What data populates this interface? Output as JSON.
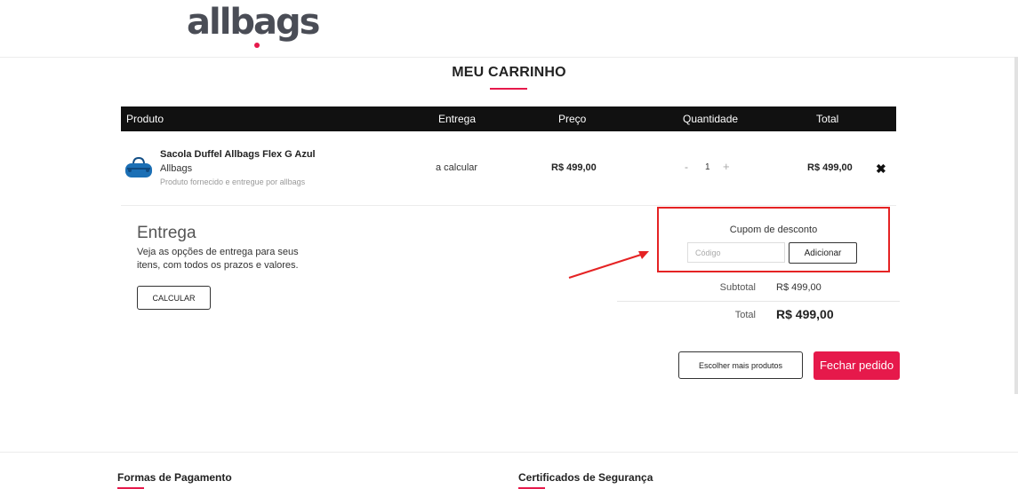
{
  "brand": {
    "logo_text": "allbags",
    "accent_color": "#e6194b"
  },
  "page": {
    "title": "MEU CARRINHO"
  },
  "cart_table": {
    "headers": {
      "product": "Produto",
      "shipping": "Entrega",
      "price": "Preço",
      "quantity": "Quantidade",
      "total": "Total"
    },
    "items": [
      {
        "name": "Sacola Duffel Allbags Flex G Azul",
        "brand": "Allbags",
        "note": "Produto fornecido e entregue por allbags",
        "shipping": "a calcular",
        "price": "R$ 499,00",
        "quantity": "1",
        "total": "R$ 499,00",
        "icon": "duffel-bag-icon",
        "icon_color": "#1b6fb5"
      }
    ],
    "qty_minus": "-",
    "qty_plus": "+",
    "remove_symbol": "✖"
  },
  "shipping": {
    "title": "Entrega",
    "description": "Veja as opções de entrega para seus itens, com todos os prazos e valores.",
    "button": "CALCULAR"
  },
  "coupon": {
    "label": "Cupom de desconto",
    "placeholder": "Código",
    "button": "Adicionar",
    "highlight_color": "#e52324"
  },
  "summary": {
    "subtotal_label": "Subtotal",
    "subtotal_value": "R$ 499,00",
    "total_label": "Total",
    "total_value": "R$ 499,00"
  },
  "actions": {
    "continue": "Escolher mais produtos",
    "checkout": "Fechar pedido"
  },
  "footer": {
    "payment_title": "Formas de Pagamento",
    "security_title": "Certificados de Segurança"
  }
}
